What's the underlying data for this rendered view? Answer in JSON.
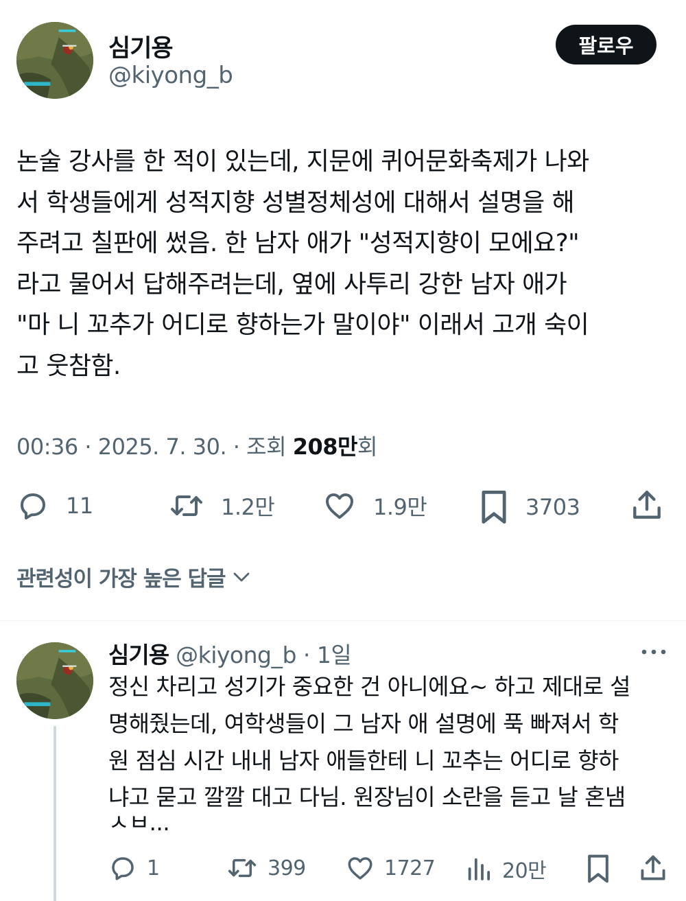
{
  "post": {
    "author_name": "심기용",
    "author_handle": "@kiyong_b",
    "follow_label": "팔로우",
    "text": "논술 강사를 한 적이 있는데, 지문에 퀴어문화축제가 나와\n서 학생들에게 성적지향 성별정체성에 대해서 설명을 해\n주려고 칠판에 썼음. 한 남자 애가 \"성적지향이 모에요?\"\n라고 물어서 답해주려는데, 옆에 사투리 강한 남자 애가\n\"마 니 꼬추가 어디로 향하는가 말이야\" 이래서 고개 숙이\n고 웃참함.",
    "meta_prefix": "00:36 · 2025. 7. 30. · 조회 ",
    "views": "208만",
    "views_suffix": "회",
    "actions": {
      "replies": "11",
      "retweets": "1.2만",
      "likes": "1.9만",
      "bookmarks": "3703"
    }
  },
  "replies_sort_label": "관련성이 가장 높은 답글",
  "reply": {
    "author_name": "심기용",
    "author_handle": "@kiyong_b",
    "separator": " · ",
    "time": "1일",
    "text": "정신 차리고 성기가 중요한 건 아니에요~ 하고 제대로 설\n명해줬는데,  여학생들이 그 남자 애 설명에 푹 빠져서 학\n원 점심 시간 내내 남자 애들한테 니 꼬추는 어디로 향하\n냐고 묻고 깔깔 대고 다님. 원장님이 소란을 듣고 날 혼냄",
    "truncated_line": "ㅅㅂ...",
    "actions": {
      "replies": "1",
      "retweets": "399",
      "likes": "1727",
      "views": "20만"
    }
  },
  "icons": {
    "reply": "reply-icon",
    "retweet": "retweet-icon",
    "like": "heart-icon",
    "bookmark": "bookmark-icon",
    "share": "share-icon",
    "views": "analytics-icon",
    "more": "more-icon",
    "chevron": "chevron-down-icon"
  },
  "colors": {
    "text": "#0f1419",
    "secondary": "#536471",
    "follow_bg": "#0f1419",
    "thread_line": "#cfd9de"
  }
}
